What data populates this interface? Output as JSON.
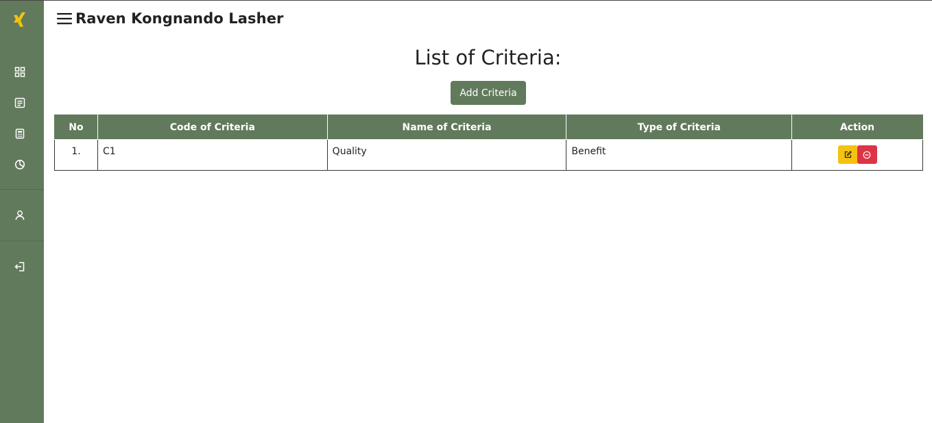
{
  "header": {
    "user_name": "Raven Kongnando Lasher"
  },
  "sidebar": {
    "logo": "xing-logo-icon",
    "items": [
      {
        "icon": "dashboard-grid-icon"
      },
      {
        "icon": "document-list-icon"
      },
      {
        "icon": "calculator-icon"
      },
      {
        "icon": "pie-chart-icon"
      },
      {
        "icon": "user-icon"
      },
      {
        "icon": "logout-icon"
      }
    ]
  },
  "main": {
    "title": "List of Criteria:",
    "add_button_label": "Add Criteria",
    "table": {
      "columns": [
        "No",
        "Code of Criteria",
        "Name of Criteria",
        "Type of Criteria",
        "Action"
      ],
      "rows": [
        {
          "no": "1.",
          "code": "C1",
          "name": "Quality",
          "type": "Benefit"
        }
      ]
    }
  },
  "colors": {
    "sidebar": "#627a5c",
    "accent_logo": "#f5c211",
    "edit": "#f5c211",
    "delete": "#dc3545"
  }
}
